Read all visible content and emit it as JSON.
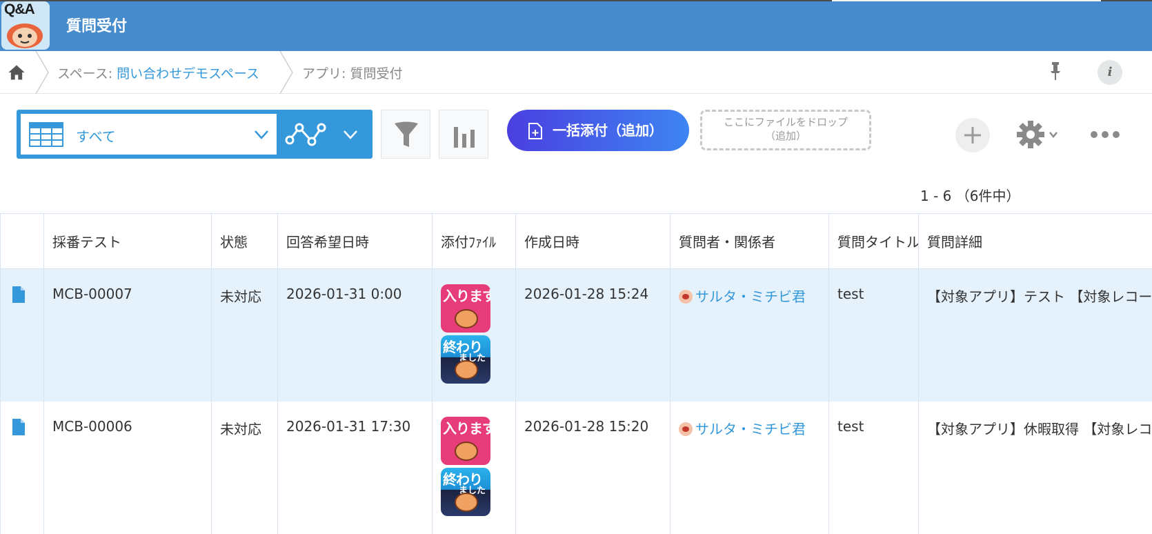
{
  "header": {
    "app_icon_text": "Q&A",
    "title": "質問受付"
  },
  "breadcrumb": {
    "space_prefix": "スペース: ",
    "space_name": "問い合わせデモスペース",
    "app_prefix": "アプリ: ",
    "app_name": "質問受付"
  },
  "toolbar": {
    "view_label": "すべて",
    "bulk_attach_label": "一括添付（追加）",
    "drop_zone_line1": "ここにファイルをドロップ",
    "drop_zone_line2": "（追加）"
  },
  "paging": {
    "range": "1 - 6 （6件中）"
  },
  "table": {
    "columns": [
      "採番テスト",
      "状態",
      "回答希望日時",
      "添付ﾌｧｲﾙ",
      "作成日時",
      "質問者・関係者",
      "質問タイトル",
      "質問詳細"
    ],
    "thumb_labels": {
      "pink_main": "入ります",
      "blue_main": "終わり",
      "blue_sub": "ました"
    },
    "rows": [
      {
        "id": "MCB-00007",
        "status": "未対応",
        "due": "2026-01-31 0:00",
        "created": "2026-01-28 15:24",
        "user": "サルタ・ミチビ君",
        "title": "test",
        "detail": "【対象アプリ】テスト 【対象レコード"
      },
      {
        "id": "MCB-00006",
        "status": "未対応",
        "due": "2026-01-31 17:30",
        "created": "2026-01-28 15:20",
        "user": "サルタ・ミチビ君",
        "title": "test",
        "detail": "【対象アプリ】休暇取得 【対象レコード"
      }
    ]
  },
  "colors": {
    "header_bg": "#468bcb",
    "accent_blue": "#3498db",
    "row_highlight": "#e6f2fb",
    "bulk_btn_start": "#4a3fe0",
    "bulk_btn_end": "#3e85f2"
  },
  "icons": [
    "home-icon",
    "pin-icon",
    "info-icon",
    "table-view-icon",
    "chevron-down-icon",
    "graph-icon",
    "filter-icon",
    "bar-chart-icon",
    "file-add-icon",
    "plus-icon",
    "gear-icon",
    "more-icon",
    "document-icon"
  ]
}
